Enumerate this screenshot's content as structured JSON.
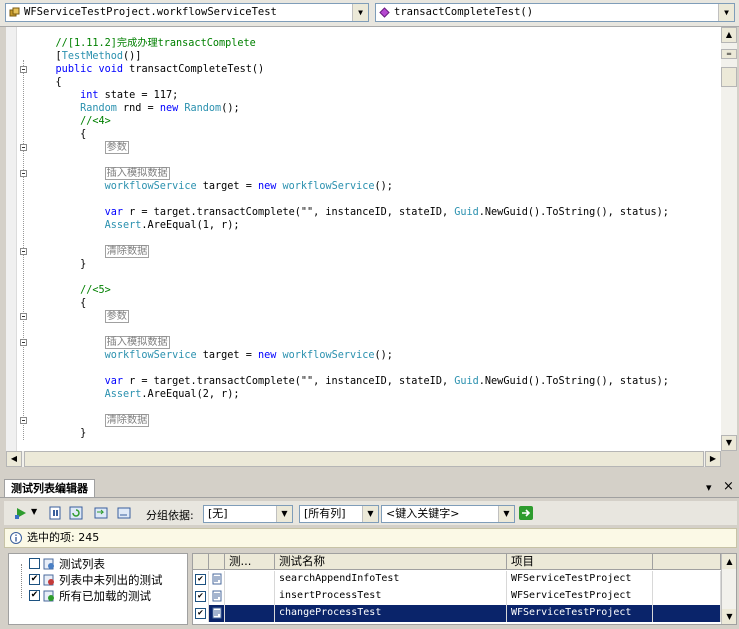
{
  "nav": {
    "class_combo": "WFServiceTestProject.workflowServiceTest",
    "member_combo": "transactCompleteTest()"
  },
  "code_lines": [
    {
      "indent": 4,
      "parts": [
        {
          "t": "//[1.11.2]完成办理transactComplete",
          "c": "cm"
        }
      ]
    },
    {
      "indent": 4,
      "parts": [
        {
          "t": "[",
          "c": ""
        },
        {
          "t": "TestMethod",
          "c": "ty"
        },
        {
          "t": "()]",
          "c": ""
        }
      ]
    },
    {
      "indent": 4,
      "parts": [
        {
          "t": "public",
          "c": "kw"
        },
        {
          "t": " ",
          "c": ""
        },
        {
          "t": "void",
          "c": "kw"
        },
        {
          "t": " transactCompleteTest()",
          "c": ""
        }
      ]
    },
    {
      "indent": 4,
      "parts": [
        {
          "t": "{",
          "c": ""
        }
      ]
    },
    {
      "indent": 8,
      "parts": [
        {
          "t": "int",
          "c": "kw"
        },
        {
          "t": " state = 117;",
          "c": ""
        }
      ]
    },
    {
      "indent": 8,
      "parts": [
        {
          "t": "Random",
          "c": "ty"
        },
        {
          "t": " rnd = ",
          "c": ""
        },
        {
          "t": "new",
          "c": "kw"
        },
        {
          "t": " ",
          "c": ""
        },
        {
          "t": "Random",
          "c": "ty"
        },
        {
          "t": "();",
          "c": ""
        }
      ]
    },
    {
      "indent": 8,
      "parts": [
        {
          "t": "//<4>",
          "c": "cm"
        }
      ]
    },
    {
      "indent": 8,
      "parts": [
        {
          "t": "{",
          "c": ""
        }
      ]
    },
    {
      "indent": 12,
      "parts": [
        {
          "t": "参数",
          "c": "region"
        }
      ]
    },
    {
      "indent": 0,
      "parts": []
    },
    {
      "indent": 12,
      "parts": [
        {
          "t": "插入模拟数据",
          "c": "region"
        }
      ]
    },
    {
      "indent": 12,
      "parts": [
        {
          "t": "workflowService",
          "c": "ty"
        },
        {
          "t": " target = ",
          "c": ""
        },
        {
          "t": "new",
          "c": "kw"
        },
        {
          "t": " ",
          "c": ""
        },
        {
          "t": "workflowService",
          "c": "ty"
        },
        {
          "t": "();",
          "c": ""
        }
      ]
    },
    {
      "indent": 0,
      "parts": []
    },
    {
      "indent": 12,
      "parts": [
        {
          "t": "var",
          "c": "kw"
        },
        {
          "t": " r = target.transactComplete(\"\", instanceID, stateID, ",
          "c": ""
        },
        {
          "t": "Guid",
          "c": "ty"
        },
        {
          "t": ".NewGuid().ToString(), status);",
          "c": ""
        }
      ]
    },
    {
      "indent": 12,
      "parts": [
        {
          "t": "Assert",
          "c": "ty"
        },
        {
          "t": ".AreEqual(1, r);",
          "c": ""
        }
      ]
    },
    {
      "indent": 0,
      "parts": []
    },
    {
      "indent": 12,
      "parts": [
        {
          "t": "清除数据",
          "c": "region"
        }
      ]
    },
    {
      "indent": 8,
      "parts": [
        {
          "t": "}",
          "c": ""
        }
      ]
    },
    {
      "indent": 0,
      "parts": []
    },
    {
      "indent": 8,
      "parts": [
        {
          "t": "//<5>",
          "c": "cm"
        }
      ]
    },
    {
      "indent": 8,
      "parts": [
        {
          "t": "{",
          "c": ""
        }
      ]
    },
    {
      "indent": 12,
      "parts": [
        {
          "t": "参数",
          "c": "region"
        }
      ]
    },
    {
      "indent": 0,
      "parts": []
    },
    {
      "indent": 12,
      "parts": [
        {
          "t": "插入模拟数据",
          "c": "region"
        }
      ]
    },
    {
      "indent": 12,
      "parts": [
        {
          "t": "workflowService",
          "c": "ty"
        },
        {
          "t": " target = ",
          "c": ""
        },
        {
          "t": "new",
          "c": "kw"
        },
        {
          "t": " ",
          "c": ""
        },
        {
          "t": "workflowService",
          "c": "ty"
        },
        {
          "t": "();",
          "c": ""
        }
      ]
    },
    {
      "indent": 0,
      "parts": []
    },
    {
      "indent": 12,
      "parts": [
        {
          "t": "var",
          "c": "kw"
        },
        {
          "t": " r = target.transactComplete(\"\", instanceID, stateID, ",
          "c": ""
        },
        {
          "t": "Guid",
          "c": "ty"
        },
        {
          "t": ".NewGuid().ToString(), status);",
          "c": ""
        }
      ]
    },
    {
      "indent": 12,
      "parts": [
        {
          "t": "Assert",
          "c": "ty"
        },
        {
          "t": ".AreEqual(2, r);",
          "c": ""
        }
      ]
    },
    {
      "indent": 0,
      "parts": []
    },
    {
      "indent": 12,
      "parts": [
        {
          "t": "清除数据",
          "c": "region"
        }
      ]
    },
    {
      "indent": 8,
      "parts": [
        {
          "t": "}",
          "c": ""
        }
      ]
    }
  ],
  "tool_window": {
    "tab_title": "测试列表编辑器",
    "pin": "▾",
    "close": "×"
  },
  "toolbar": {
    "group_by_label": "分组依据:",
    "group_by_value": "[无]",
    "columns_value": "[所有列]",
    "keyword_placeholder": "<键入关键字>"
  },
  "info": {
    "selected_label": "选中的项: 245"
  },
  "tree": [
    {
      "label": "测试列表",
      "checked": false,
      "icon": "test-list-icon"
    },
    {
      "label": "列表中未列出的测试",
      "checked": true,
      "icon": "unlisted-tests-icon"
    },
    {
      "label": "所有已加载的测试",
      "checked": true,
      "icon": "all-tests-icon"
    }
  ],
  "grid": {
    "headers": [
      "",
      "测...",
      "测试名称",
      "项目"
    ],
    "rows": [
      {
        "checked": true,
        "category": "",
        "name": "searchAppendInfoTest",
        "project": "WFServiceTestProject",
        "selected": false
      },
      {
        "checked": true,
        "category": "",
        "name": "insertProcessTest",
        "project": "WFServiceTestProject",
        "selected": false
      },
      {
        "checked": true,
        "category": "",
        "name": "changeProcessTest",
        "project": "WFServiceTestProject",
        "selected": true
      }
    ]
  },
  "colors": {
    "keyword": "#0000ff",
    "comment": "#008000",
    "type": "#2b91af",
    "selection": "#0a246a"
  }
}
